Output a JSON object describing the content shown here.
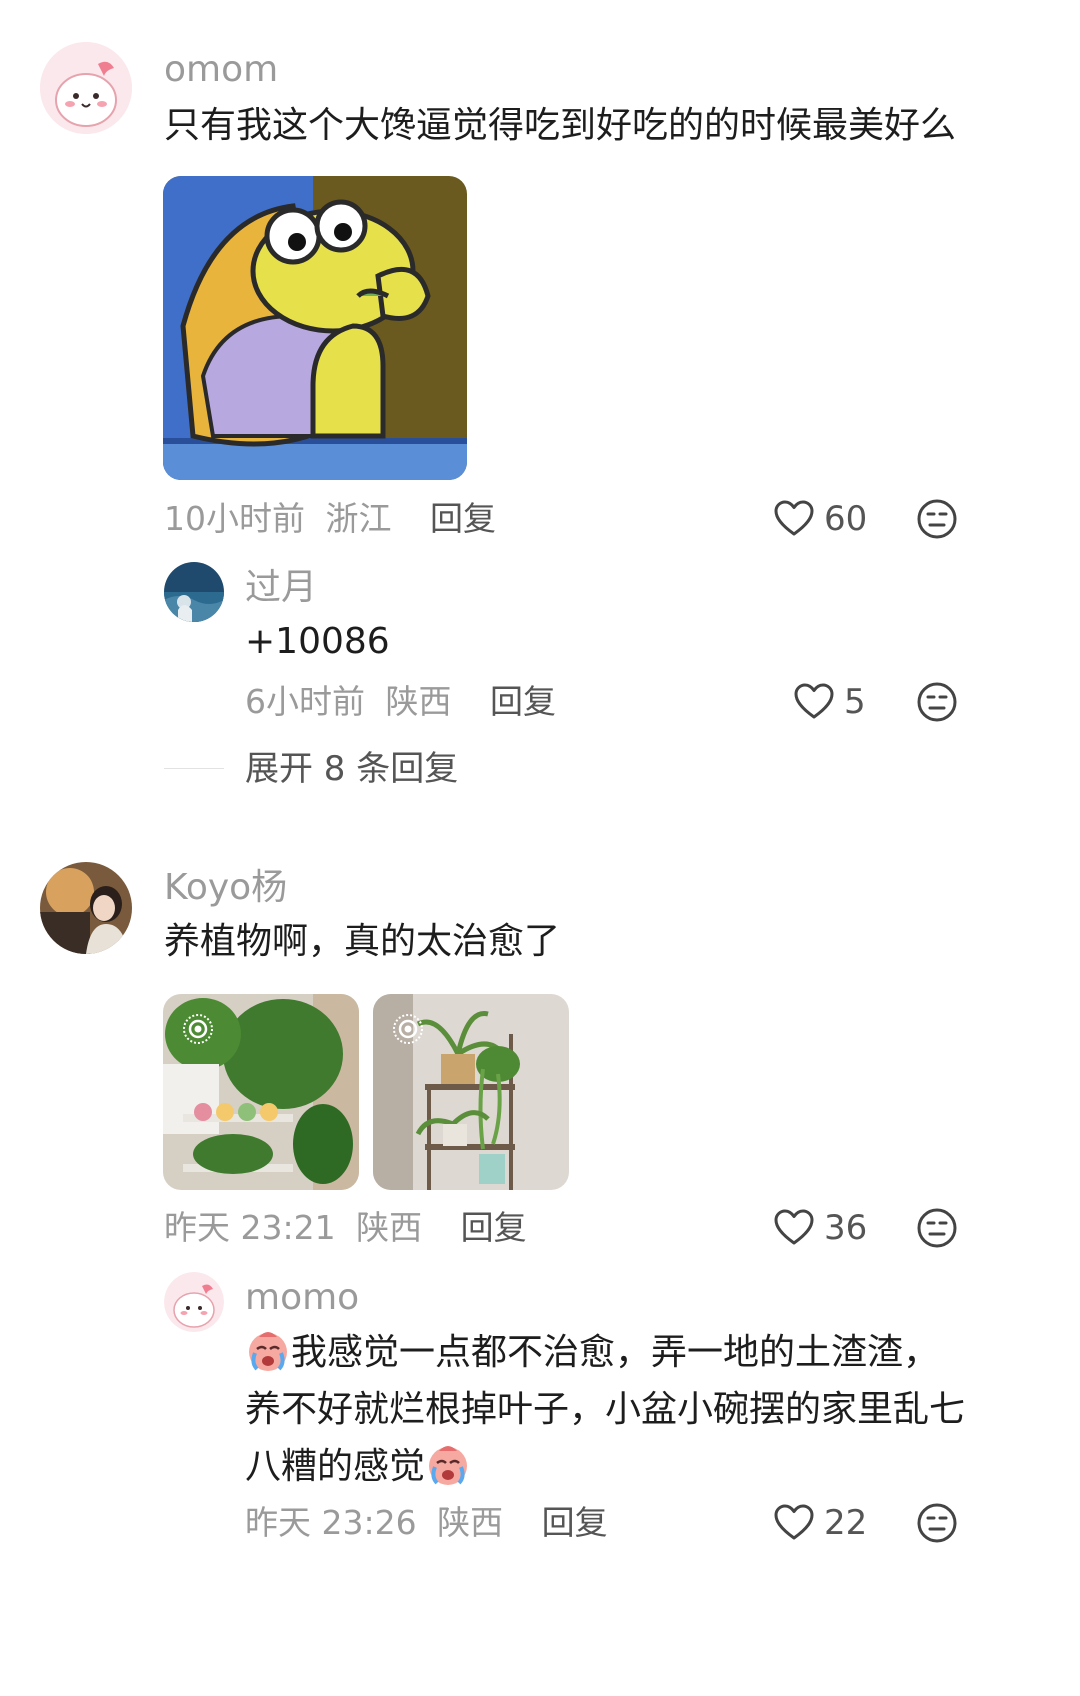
{
  "comments": [
    {
      "username": "omom",
      "text": "只有我这个大馋逼觉得吃到好吃的的时候最美好么",
      "time": "10小时前",
      "location": "浙江",
      "reply_label": "回复",
      "likes": "60",
      "replies": [
        {
          "username": "过月",
          "text": "+10086",
          "time": "6小时前",
          "location": "陕西",
          "reply_label": "回复",
          "likes": "5"
        }
      ],
      "expand_label": "展开 8 条回复"
    },
    {
      "username": "Koyo杨",
      "text": "养植物啊，真的太治愈了",
      "time": "昨天 23:21",
      "location": "陕西",
      "reply_label": "回复",
      "likes": "36",
      "replies": [
        {
          "username": "momo",
          "text_parts": [
            "我感觉一点都不治愈，弄一地的土渣渣，",
            "养不好就烂根掉叶子，小盆小碗摆的家里乱七",
            "八糟的感觉"
          ],
          "time": "昨天 23:26",
          "location": "陕西",
          "reply_label": "回复",
          "likes": "22"
        }
      ]
    }
  ],
  "colors": {
    "muted_text": "#9a9a9a",
    "body_text": "#1d1d1d",
    "action_text": "#555555",
    "background": "#ffffff"
  },
  "icons": [
    "heart-icon",
    "meh-face-icon",
    "live-photo-icon",
    "crying-emoji-icon"
  ]
}
